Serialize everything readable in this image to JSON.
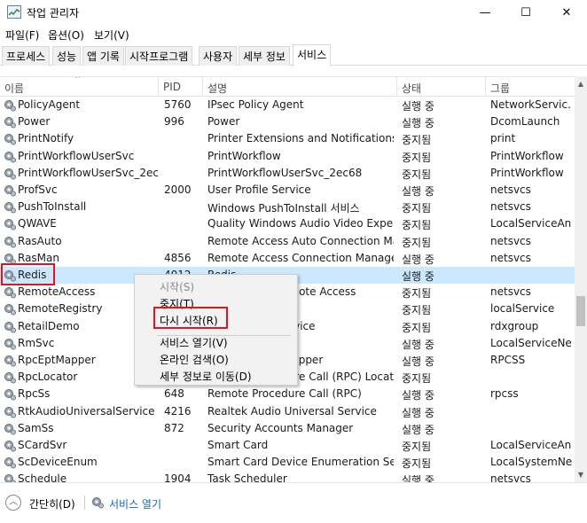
{
  "window": {
    "title": "작업 관리자",
    "controls": {
      "minimize": "—",
      "maximize": "☐",
      "close": "✕"
    }
  },
  "menu": [
    "파일(F)",
    "옵션(O)",
    "보기(V)"
  ],
  "tabs": [
    {
      "label": "프로세스"
    },
    {
      "label": "성능"
    },
    {
      "label": "앱 기록"
    },
    {
      "label": "시작프로그램"
    },
    {
      "label": "사용자"
    },
    {
      "label": "세부 정보"
    },
    {
      "label": "서비스",
      "active": true
    }
  ],
  "table": {
    "headers": {
      "name": "이름",
      "pid": "PID",
      "desc": "설명",
      "status": "상태",
      "group": "그룹"
    },
    "sort_arrow": "^",
    "rows": [
      {
        "name": "PolicyAgent",
        "pid": "5760",
        "desc": "IPsec Policy Agent",
        "status": "실행 중",
        "group": "NetworkServic..."
      },
      {
        "name": "Power",
        "pid": "996",
        "desc": "Power",
        "status": "실행 중",
        "group": "DcomLaunch"
      },
      {
        "name": "PrintNotify",
        "pid": "",
        "desc": "Printer Extensions and Notifications",
        "status": "중지됨",
        "group": "print"
      },
      {
        "name": "PrintWorkflowUserSvc",
        "pid": "",
        "desc": "PrintWorkflow",
        "status": "중지됨",
        "group": "PrintWorkflow"
      },
      {
        "name": "PrintWorkflowUserSvc_2ec68",
        "pid": "",
        "desc": "PrintWorkflowUserSvc_2ec68",
        "status": "중지됨",
        "group": "PrintWorkflow"
      },
      {
        "name": "ProfSvc",
        "pid": "2000",
        "desc": "User Profile Service",
        "status": "실행 중",
        "group": "netsvcs"
      },
      {
        "name": "PushToInstall",
        "pid": "",
        "desc": "Windows PushToInstall 서비스",
        "status": "중지됨",
        "group": "netsvcs"
      },
      {
        "name": "QWAVE",
        "pid": "",
        "desc": "Quality Windows Audio Video Exper...",
        "status": "중지됨",
        "group": "LocalServiceAn..."
      },
      {
        "name": "RasAuto",
        "pid": "",
        "desc": "Remote Access Auto Connection Ma...",
        "status": "중지됨",
        "group": "netsvcs"
      },
      {
        "name": "RasMan",
        "pid": "4856",
        "desc": "Remote Access Connection Manager",
        "status": "실행 중",
        "group": "netsvcs"
      },
      {
        "name": "Redis",
        "pid": "4012",
        "desc": "Redis",
        "status": "실행 중",
        "group": "",
        "selected": true
      },
      {
        "name": "RemoteAccess",
        "pid": "",
        "desc": "Routing and Remote Access",
        "status": "중지됨",
        "group": "netsvcs"
      },
      {
        "name": "RemoteRegistry",
        "pid": "",
        "desc": "Remote Registry",
        "status": "중지됨",
        "group": "localService"
      },
      {
        "name": "RetailDemo",
        "pid": "",
        "desc": "Retail Demo Service",
        "status": "중지됨",
        "group": "rdxgroup"
      },
      {
        "name": "RmSvc",
        "pid": "",
        "desc": "무선 관리 서비스",
        "status": "실행 중",
        "group": "LocalServiceNe..."
      },
      {
        "name": "RpcEptMapper",
        "pid": "",
        "desc": "RPC Endpoint Mapper",
        "status": "실행 중",
        "group": "RPCSS"
      },
      {
        "name": "RpcLocator",
        "pid": "",
        "desc": "Remote Procedure Call (RPC) Locator",
        "status": "중지됨",
        "group": ""
      },
      {
        "name": "RpcSs",
        "pid": "648",
        "desc": "Remote Procedure Call (RPC)",
        "status": "실행 중",
        "group": "rpcss"
      },
      {
        "name": "RtkAudioUniversalService",
        "pid": "4216",
        "desc": "Realtek Audio Universal Service",
        "status": "실행 중",
        "group": ""
      },
      {
        "name": "SamSs",
        "pid": "872",
        "desc": "Security Accounts Manager",
        "status": "실행 중",
        "group": ""
      },
      {
        "name": "SCardSvr",
        "pid": "",
        "desc": "Smart Card",
        "status": "중지됨",
        "group": "LocalServiceAn..."
      },
      {
        "name": "ScDeviceEnum",
        "pid": "",
        "desc": "Smart Card Device Enumeration Ser...",
        "status": "중지됨",
        "group": "LocalSystemNe..."
      },
      {
        "name": "Schedule",
        "pid": "1904",
        "desc": "Task Scheduler",
        "status": "실행 중",
        "group": "netsvcs"
      }
    ]
  },
  "context_menu": {
    "items": [
      {
        "label": "시작(S)",
        "disabled": true
      },
      {
        "label": "중지(T)"
      },
      {
        "label": "다시 시작(R)"
      },
      {
        "label": "서비스 열기(V)"
      },
      {
        "label": "온라인 검색(O)"
      },
      {
        "label": "세부 정보로 이동(D)"
      }
    ]
  },
  "footer": {
    "less_label": "간단히(D)",
    "open_services_label": "서비스 열기"
  },
  "colors": {
    "selection": "#cce8ff",
    "highlight_box": "#e0141e",
    "link": "#1565c0"
  },
  "icons": {
    "row_icon": "gear-icon",
    "collapse": "chevron-up-icon"
  }
}
